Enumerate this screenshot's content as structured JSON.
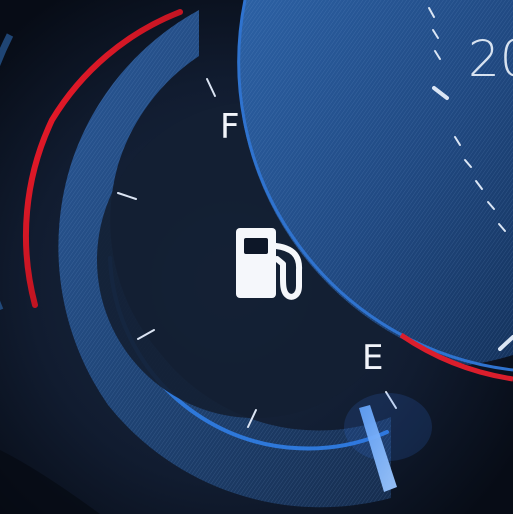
{
  "gauge": {
    "full_label": "F",
    "empty_label": "E",
    "icon_name": "fuel-pump-icon",
    "speedometer_partial_label": "20"
  },
  "colors": {
    "background": "#0e1727",
    "accent_blue": "#2b74c7",
    "accent_red": "#e11a2b",
    "needle": "#6ea9ff",
    "text": "#f2f5fb"
  }
}
